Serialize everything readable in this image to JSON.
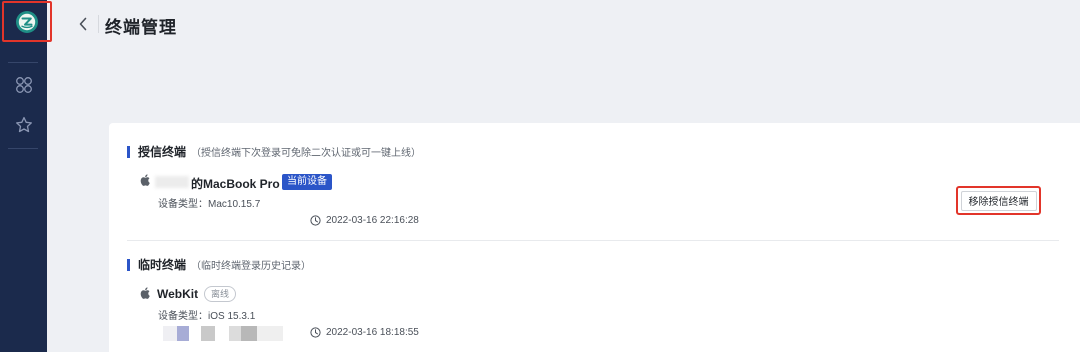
{
  "sidebar": {
    "logo_icon": "app-logo-icon",
    "items": [
      {
        "icon": "apps-grid-icon"
      },
      {
        "icon": "star-icon"
      }
    ]
  },
  "header": {
    "title": "终端管理",
    "back_icon": "chevron-left-icon"
  },
  "trusted": {
    "title": "授信终端",
    "note": "（授信终端下次登录可免除二次认证或可一键上线）",
    "device": {
      "name": "的MacBook Pro",
      "badge": "当前设备",
      "type_label": "设备类型：",
      "type_value": "Mac10.15.7",
      "time": "2022-03-16 22:16:28",
      "remove_label": "移除授信终端"
    }
  },
  "temporary": {
    "title": "临时终端",
    "note": "（临时终端登录历史记录）",
    "device": {
      "name": "WebKit",
      "badge": "离线",
      "type_label": "设备类型：",
      "type_value": "iOS 15.3.1",
      "time": "2022-03-16 18:18:55"
    }
  },
  "colors": {
    "sidebar_bg": "#1b2a4c",
    "accent": "#2b55c8",
    "highlight_red": "#e2352a"
  }
}
